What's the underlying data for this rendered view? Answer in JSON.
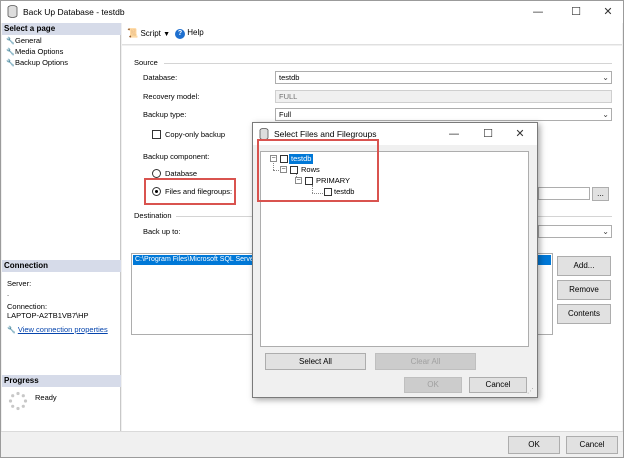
{
  "window": {
    "title": "Back Up Database - testdb",
    "minimize": "—",
    "maximize": "☐",
    "close": "✕"
  },
  "left": {
    "select_page_header": "Select a page",
    "pages": [
      "General",
      "Media Options",
      "Backup Options"
    ],
    "connection_header": "Connection",
    "server_label": "Server:",
    "server_value": ".",
    "connection_label": "Connection:",
    "connection_value": "LAPTOP-A2TB1VB7\\HP",
    "view_connection_link": "View connection properties",
    "progress_header": "Progress",
    "progress_status": "Ready"
  },
  "toolbar": {
    "script_label": "Script",
    "help_label": "Help"
  },
  "form": {
    "source_label": "Source",
    "database_label": "Database:",
    "database_value": "testdb",
    "recovery_model_label": "Recovery model:",
    "recovery_model_value": "FULL",
    "backup_type_label": "Backup type:",
    "backup_type_value": "Full",
    "copy_only_label": "Copy-only backup",
    "backup_component_label": "Backup component:",
    "database_radio_label": "Database",
    "files_radio_label": "Files and filegroups:",
    "browse_label": "...",
    "destination_label": "Destination",
    "back_up_to_label": "Back up to:",
    "destination_path": "C:\\Program Files\\Microsoft SQL Server",
    "add_button": "Add...",
    "remove_button": "Remove",
    "contents_button": "Contents"
  },
  "footer": {
    "ok_button": "OK",
    "cancel_button": "Cancel"
  },
  "dialog": {
    "title": "Select Files and Filegroups",
    "minimize": "—",
    "maximize": "☐",
    "close": "✕",
    "tree": {
      "root": "testdb",
      "rows": "Rows",
      "primary": "PRIMARY",
      "file": "testdb"
    },
    "select_all_button": "Select All",
    "clear_all_button": "Clear All",
    "ok_button": "OK",
    "cancel_button": "Cancel"
  },
  "colors": {
    "highlight": "#0078d7",
    "annotation_red": "#d9534f",
    "section_header": "#d6dbe9"
  }
}
